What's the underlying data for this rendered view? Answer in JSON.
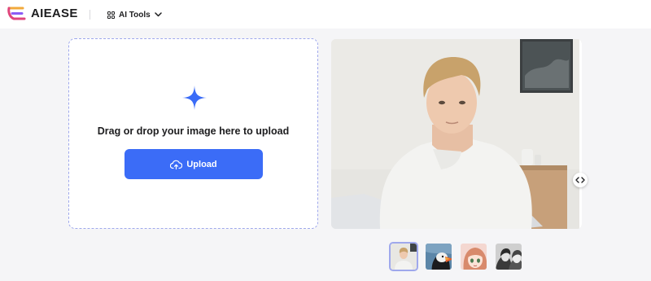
{
  "header": {
    "brand": "AIEASE",
    "ai_tools_label": "AI Tools"
  },
  "upload": {
    "drop_text": "Drag or drop your image here to upload",
    "button_label": "Upload"
  },
  "colors": {
    "accent": "#3b6cf7",
    "card_border": "#9fa8ec",
    "background": "#f5f5f7",
    "logo_colors": [
      "#f2a93b",
      "#8b5cf6",
      "#e0457b"
    ]
  },
  "icons": {
    "logo": "aiease-logo-icon",
    "tools": "grid-icon",
    "dropdown": "chevron-down-icon",
    "add": "plus-icon",
    "upload": "cloud-upload-icon",
    "compare": "compare-arrows-icon"
  },
  "samples": [
    {
      "name": "sample-man-portrait",
      "active": true
    },
    {
      "name": "sample-puffin",
      "active": false
    },
    {
      "name": "sample-anime-girl",
      "active": false
    },
    {
      "name": "sample-bw-women",
      "active": false
    }
  ]
}
